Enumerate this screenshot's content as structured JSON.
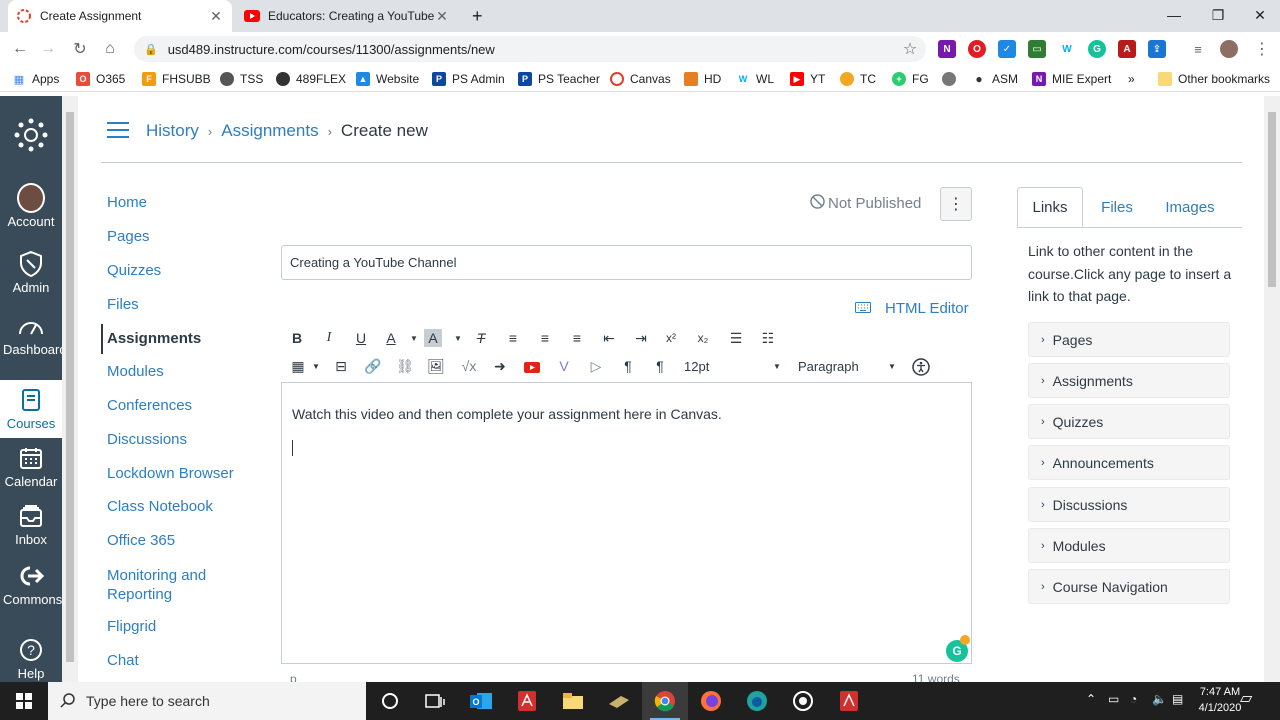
{
  "browser": {
    "tabs": [
      {
        "title": "Create Assignment"
      },
      {
        "title": "Educators: Creating a YouTube C"
      }
    ],
    "url": "usd489.instructure.com/courses/11300/assignments/new",
    "bookmarks": [
      "Apps",
      "O365",
      "FHSUBB",
      "TSS",
      "489FLEX",
      "Website",
      "PS Admin",
      "PS Teacher",
      "Canvas",
      "HD",
      "WL",
      "YT",
      "TC",
      "FG",
      "ASM",
      "MIE Expert"
    ],
    "other_bookmarks": "Other bookmarks",
    "more_bookmarks": "»"
  },
  "globalnav": {
    "items": [
      {
        "label": "Account"
      },
      {
        "label": "Admin"
      },
      {
        "label": "Dashboard"
      },
      {
        "label": "Courses"
      },
      {
        "label": "Calendar"
      },
      {
        "label": "Inbox"
      },
      {
        "label": "Commons"
      },
      {
        "label": "Help"
      }
    ]
  },
  "breadcrumb": {
    "course": "History",
    "section": "Assignments",
    "current": "Create new",
    "sep": "›"
  },
  "coursenav": {
    "items": [
      "Home",
      "Pages",
      "Quizzes",
      "Files",
      "Assignments",
      "Modules",
      "Conferences",
      "Discussions",
      "Lockdown Browser",
      "Class Notebook",
      "Office 365",
      "Monitoring and Reporting",
      "Flipgrid",
      "Chat"
    ]
  },
  "assignment": {
    "status": "Not Published",
    "title_value": "Creating a YouTube Channel",
    "html_editor_label": "HTML Editor",
    "body_text": "Watch this video and then complete your assignment here in Canvas.",
    "font_size": "12pt",
    "block_format": "Paragraph",
    "status_path": "p",
    "word_count": "11 words"
  },
  "sidebar": {
    "tabs": [
      "Links",
      "Files",
      "Images"
    ],
    "description": "Link to other content in the course.Click any page to insert a link to that page.",
    "sections": [
      "Pages",
      "Assignments",
      "Quizzes",
      "Announcements",
      "Discussions",
      "Modules",
      "Course Navigation"
    ]
  },
  "taskbar": {
    "search_placeholder": "Type here to search",
    "time": "7:47 AM",
    "date": "4/1/2020"
  },
  "colors": {
    "canvas_nav": "#394b58",
    "link": "#2d7ec2",
    "text": "#2d3b45"
  }
}
